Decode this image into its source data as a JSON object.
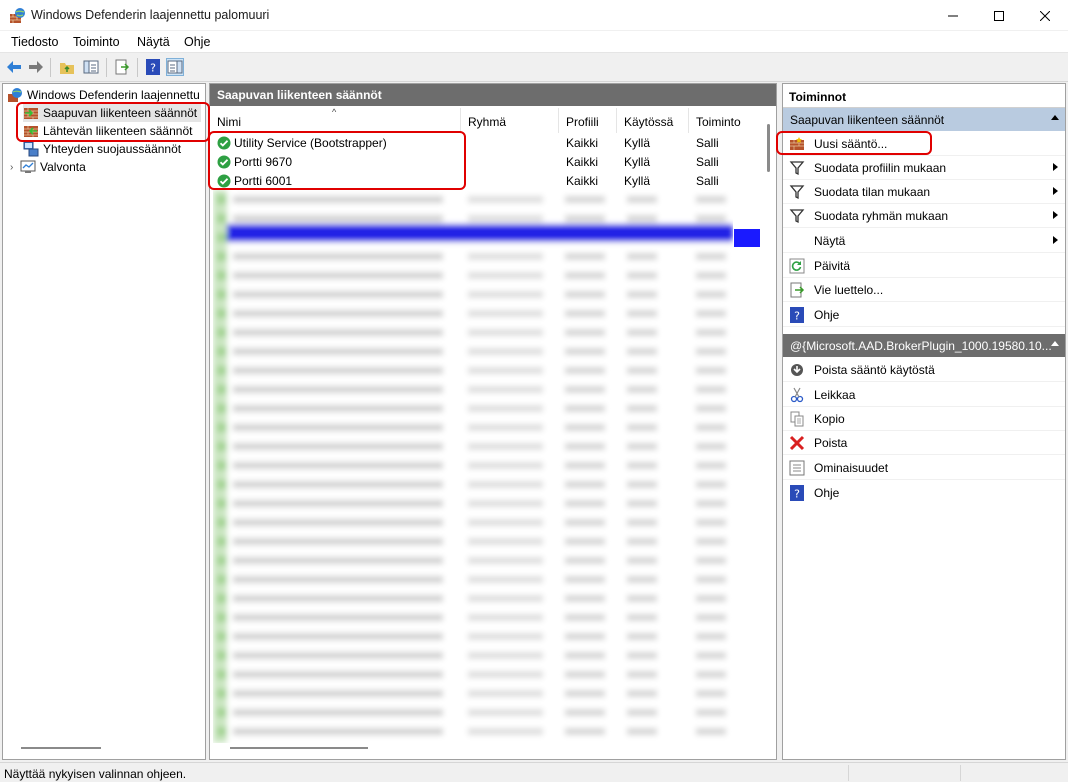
{
  "window": {
    "title": "Windows Defenderin laajennettu palomuuri"
  },
  "menu": [
    "Tiedosto",
    "Toiminto",
    "Näytä",
    "Ohje"
  ],
  "tree": {
    "root": "Windows Defenderin laajennettu",
    "items": [
      {
        "label": "Saapuvan liikenteen säännöt",
        "icon": "inbound-rules-icon"
      },
      {
        "label": "Lähtevän liikenteen säännöt",
        "icon": "outbound-rules-icon"
      },
      {
        "label": "Yhteyden suojaussäännöt",
        "icon": "connection-security-icon"
      },
      {
        "label": "Valvonta",
        "icon": "monitoring-icon"
      }
    ]
  },
  "center": {
    "header": "Saapuvan liikenteen säännöt",
    "columns": [
      "Nimi",
      "Ryhmä",
      "Profiili",
      "Käytössä",
      "Toiminto"
    ],
    "rows": [
      {
        "name": "Utility Service (Bootstrapper)",
        "group": "",
        "profile": "Kaikki",
        "enabled": "Kyllä",
        "action": "Salli"
      },
      {
        "name": "Portti 9670",
        "group": "",
        "profile": "Kaikki",
        "enabled": "Kyllä",
        "action": "Salli"
      },
      {
        "name": "Portti 6001",
        "group": "",
        "profile": "Kaikki",
        "enabled": "Kyllä",
        "action": "Salli"
      }
    ]
  },
  "actions": {
    "title": "Toiminnot",
    "section1": {
      "label": "Saapuvan liikenteen säännöt",
      "items": [
        {
          "label": "Uusi sääntö...",
          "icon": "new-rule-icon",
          "submenu": false
        },
        {
          "label": "Suodata profiilin mukaan",
          "icon": "filter-icon",
          "submenu": true
        },
        {
          "label": "Suodata tilan mukaan",
          "icon": "filter-icon",
          "submenu": true
        },
        {
          "label": "Suodata ryhmän mukaan",
          "icon": "filter-icon",
          "submenu": true
        },
        {
          "label": "Näytä",
          "icon": "",
          "submenu": true
        },
        {
          "label": "Päivitä",
          "icon": "refresh-icon",
          "submenu": false
        },
        {
          "label": "Vie luettelo...",
          "icon": "export-icon",
          "submenu": false
        },
        {
          "label": "Ohje",
          "icon": "help-icon",
          "submenu": false
        }
      ]
    },
    "section2": {
      "label": "@{Microsoft.AAD.BrokerPlugin_1000.19580.10...",
      "items": [
        {
          "label": "Poista sääntö käytöstä",
          "icon": "disable-rule-icon"
        },
        {
          "label": "Leikkaa",
          "icon": "cut-icon"
        },
        {
          "label": "Kopio",
          "icon": "copy-icon"
        },
        {
          "label": "Poista",
          "icon": "delete-icon"
        },
        {
          "label": "Ominaisuudet",
          "icon": "properties-icon"
        },
        {
          "label": "Ohje",
          "icon": "help-icon"
        }
      ]
    }
  },
  "status": {
    "text": "Näyttää nykyisen valinnan ohjeen."
  },
  "colors": {
    "highlight": "#e00000",
    "section_blue": "#b9cbe0",
    "pane_header": "#6d6d6d",
    "selection_bar": "#1a1aff"
  }
}
